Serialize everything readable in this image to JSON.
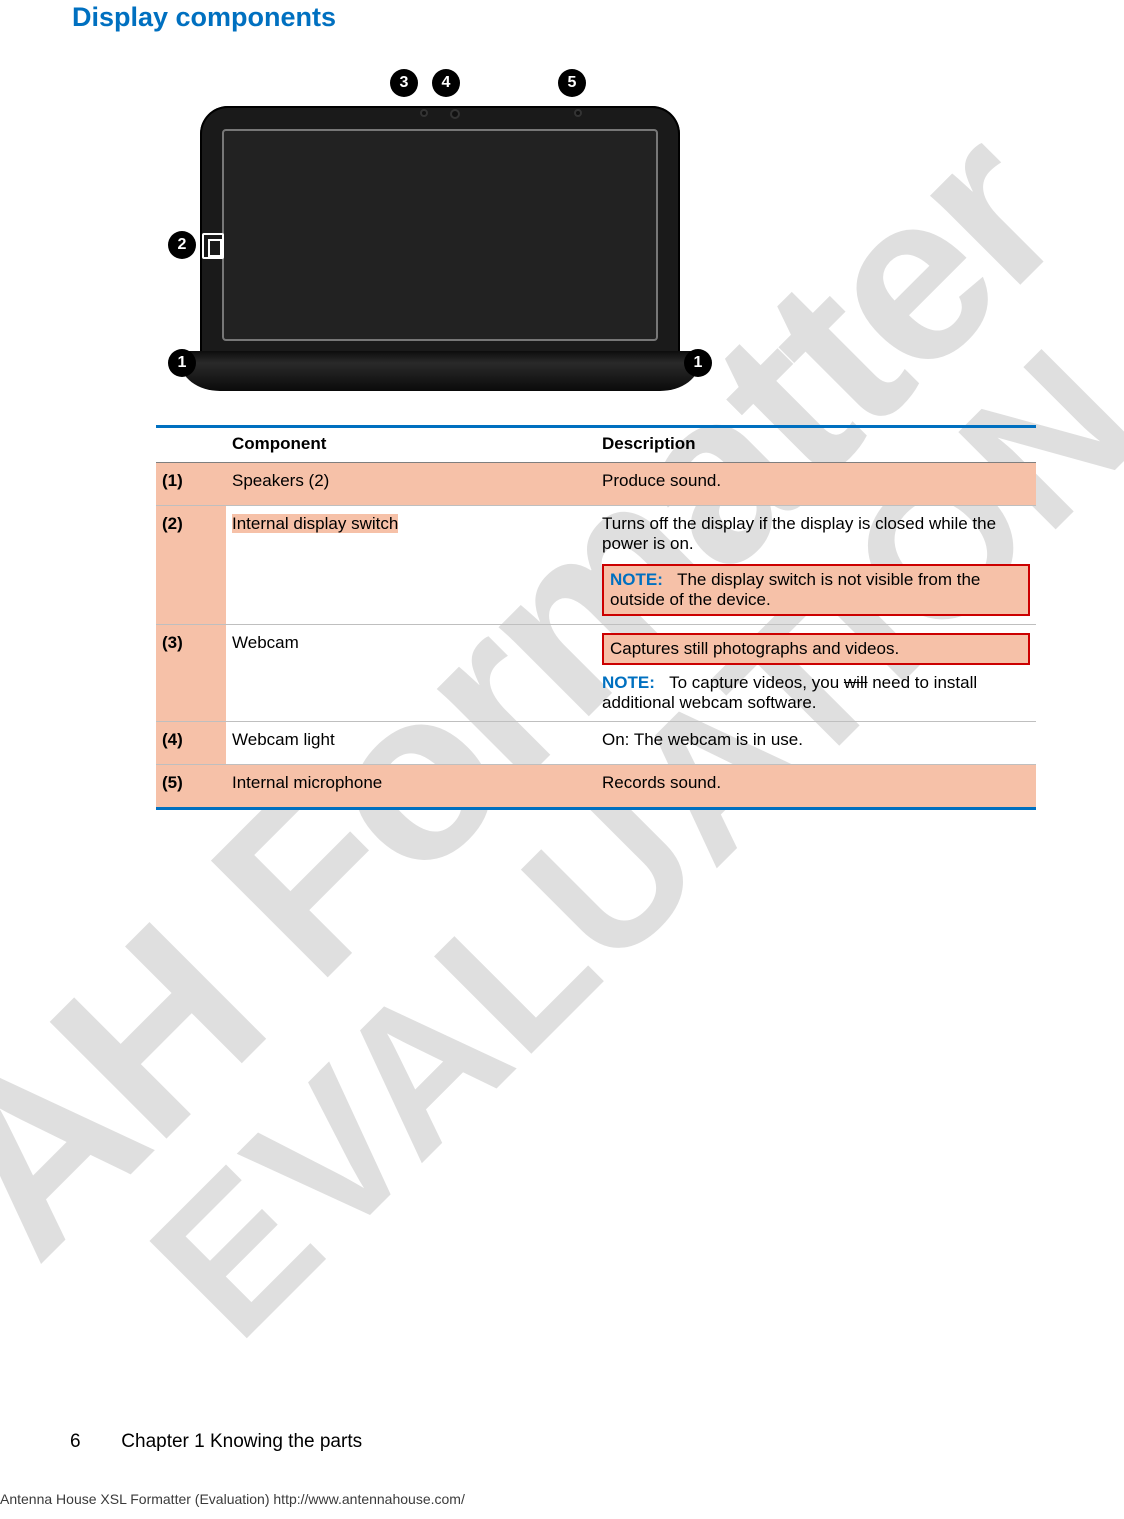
{
  "watermark": {
    "line1": "AH Formatter",
    "line2": "EVALUATION"
  },
  "section_title": "Display components",
  "table": {
    "headers": {
      "num": "",
      "component": "Component",
      "description": "Description"
    },
    "rows": [
      {
        "num": "(1)",
        "component": "Speakers (2)",
        "description": {
          "text": "Produce sound."
        }
      },
      {
        "num": "(2)",
        "component": "Internal display switch",
        "description": {
          "text": "Turns off the display if the display is closed while the power is on.",
          "note_label": "NOTE:",
          "note_text": "The display switch is not visible from the outside of the device."
        }
      },
      {
        "num": "(3)",
        "component": "Webcam",
        "description": {
          "text": "Captures still photographs and videos.",
          "note_label": "NOTE:",
          "note_prefix": "To capture videos, you ",
          "note_strike": "will",
          "note_suffix": " need to install additional webcam software."
        }
      },
      {
        "num": "(4)",
        "component": "Webcam light",
        "description": {
          "text": "On: The webcam is in use."
        }
      },
      {
        "num": "(5)",
        "component": "Internal microphone",
        "description": {
          "text": "Records sound."
        }
      }
    ]
  },
  "callouts": {
    "c1": "1",
    "c2": "2",
    "c3": "3",
    "c4": "4",
    "c5": "5"
  },
  "footer": {
    "page": "6",
    "chapter": "Chapter 1   Knowing the parts"
  },
  "eval_line": "Antenna House XSL Formatter (Evaluation)  http://www.antennahouse.com/"
}
